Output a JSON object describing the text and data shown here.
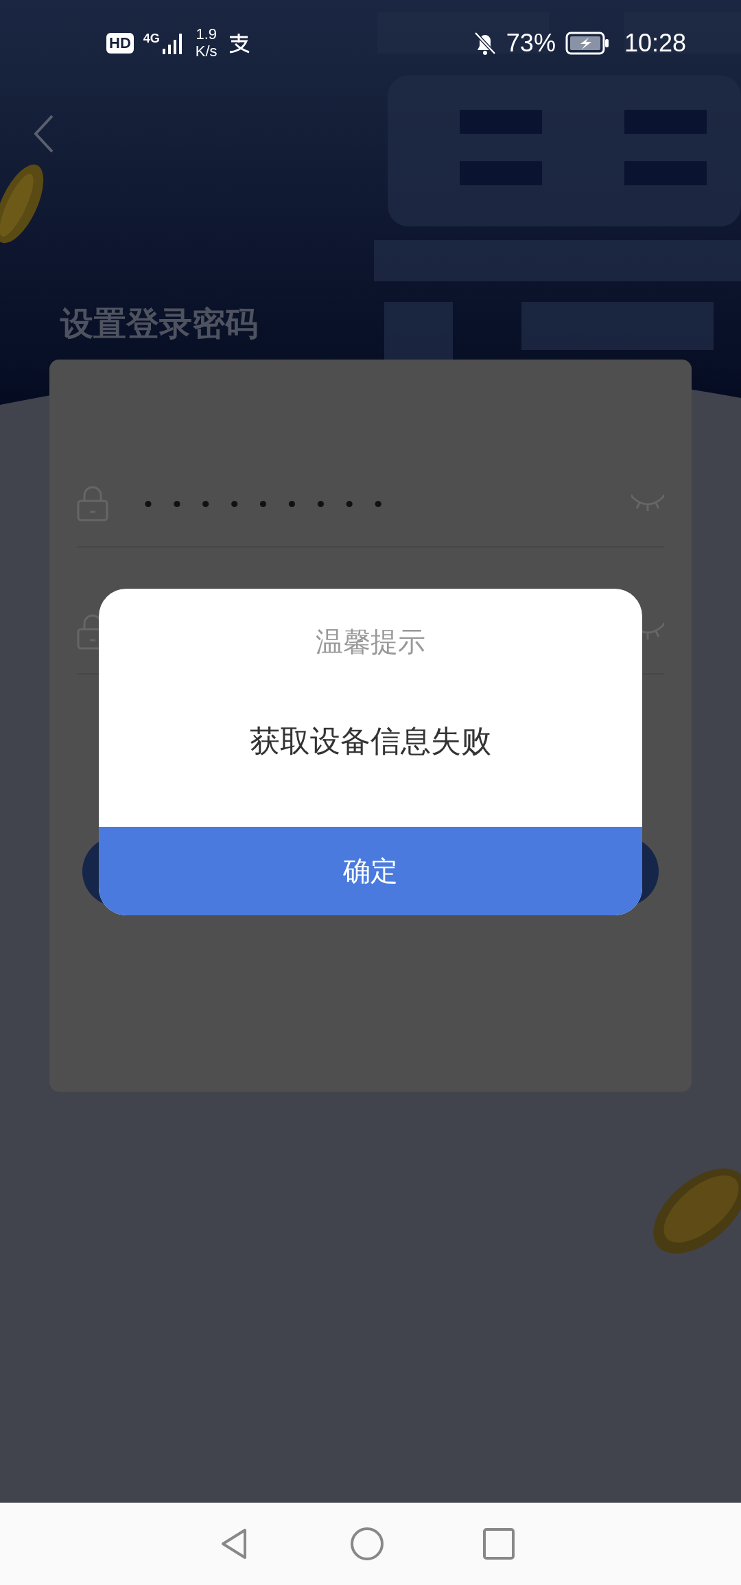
{
  "status_bar": {
    "hd_badge": "HD",
    "network_type": "4G",
    "network_speed": "1.9",
    "network_speed_unit": "K/s",
    "battery": "73%",
    "time": "10:28"
  },
  "page": {
    "title": "设置登录密码"
  },
  "form": {
    "fields": [
      {
        "value": "•••••••••",
        "masked": true
      },
      {
        "masked": true
      }
    ]
  },
  "dialog": {
    "title": "温馨提示",
    "message": "获取设备信息失败",
    "button": "确定"
  }
}
